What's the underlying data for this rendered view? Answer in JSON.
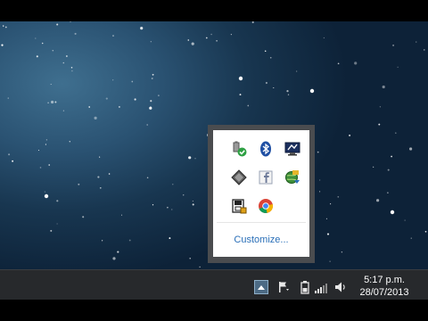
{
  "overflow": {
    "icons": [
      {
        "name": "usb-safely-remove-icon"
      },
      {
        "name": "bluetooth-icon"
      },
      {
        "name": "display-monitor-icon"
      },
      {
        "name": "diamond-app-icon"
      },
      {
        "name": "facebook-icon"
      },
      {
        "name": "globe-network-icon"
      },
      {
        "name": "save-disk-icon"
      },
      {
        "name": "chrome-icon"
      }
    ],
    "customize_label": "Customize..."
  },
  "taskbar": {
    "tray_icons": [
      "action-center-flag-icon",
      "battery-icon",
      "network-signal-icon",
      "volume-icon"
    ],
    "clock": {
      "time": "5:17 p.m.",
      "date": "28/07/2013"
    }
  },
  "colors": {
    "taskbar": "#27292c",
    "popup_frame": "#4a4c4f",
    "link": "#2a6fb8"
  }
}
